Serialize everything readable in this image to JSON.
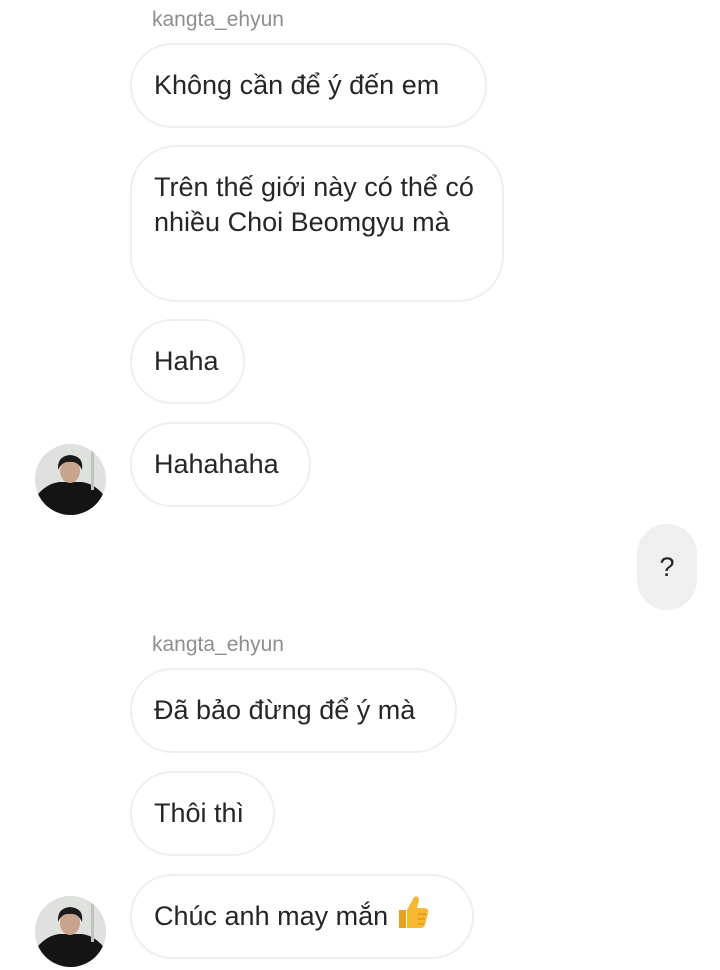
{
  "thread": {
    "group1": {
      "sender": "kangta_ehyun",
      "messages": [
        "Không cần để ý đến em",
        "Trên thế giới này có thể có nhiều Choi Beomgyu mà",
        "Haha",
        "Hahahaha"
      ]
    },
    "sent": {
      "message": "?"
    },
    "group2": {
      "sender": "kangta_ehyun",
      "messages": [
        "Đã bảo đừng để ý mà",
        "Thôi thì",
        "Chúc anh may mắn"
      ],
      "last_emoji": "thumbs-up-emoji"
    }
  },
  "colors": {
    "received_bubble_border": "#efefef",
    "sent_bubble_bg": "#efefef",
    "username_text": "#8e8e8e",
    "message_text": "#262626",
    "emoji_yellow": "#f5b82e"
  }
}
